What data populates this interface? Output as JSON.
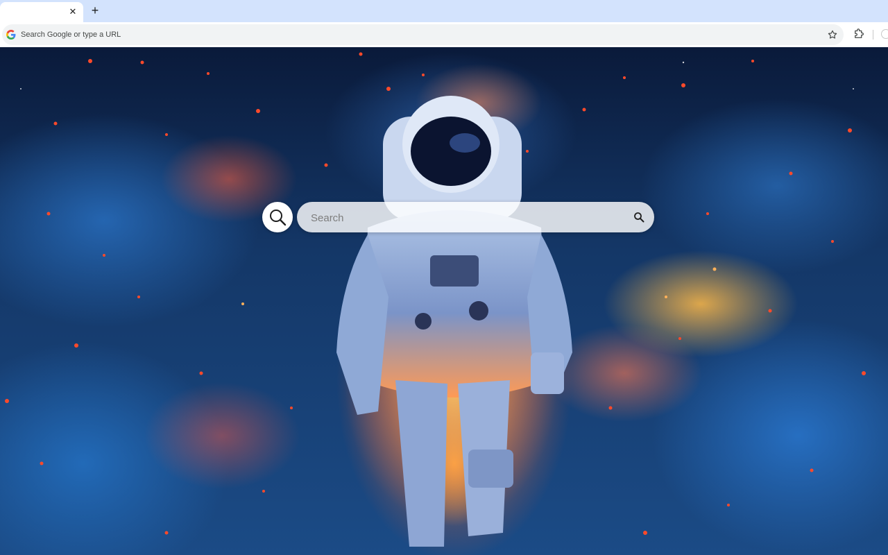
{
  "browser": {
    "tab": {
      "close_glyph": "✕",
      "close_icon": "close-icon"
    },
    "new_tab_glyph": "+",
    "omnibox": {
      "placeholder": "Search Google or type a URL",
      "icon": "google-g-icon"
    },
    "bookmark_icon": "star-icon",
    "extensions_icon": "puzzle-icon",
    "profile_icon": "profile-icon"
  },
  "new_tab_page": {
    "search": {
      "placeholder": "Search",
      "value": "",
      "icon": "search-icon"
    },
    "logo_icon": "magnifier-logo-icon",
    "wallpaper": "astronaut-in-fiery-clouds"
  },
  "colors": {
    "tabstrip_bg": "#d3e3fd",
    "toolbar_bg": "#ffffff",
    "omnibox_bg": "#f1f3f4"
  }
}
